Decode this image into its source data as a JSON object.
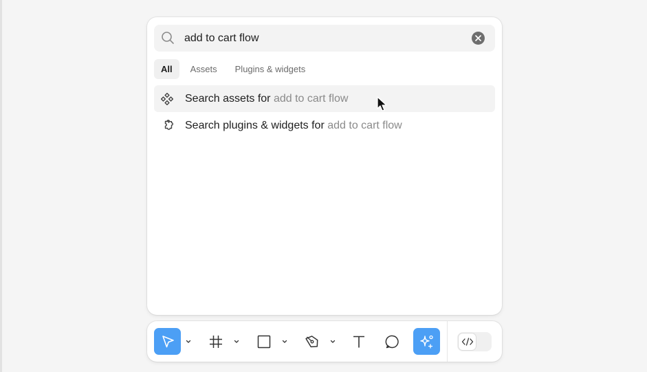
{
  "search": {
    "value": "add to cart flow",
    "placeholder": ""
  },
  "filter_tabs": [
    {
      "label": "All",
      "active": true
    },
    {
      "label": "Assets",
      "active": false
    },
    {
      "label": "Plugins & widgets",
      "active": false
    }
  ],
  "results": [
    {
      "icon": "component-icon",
      "prefix": "Search assets for",
      "query": "add to cart flow"
    },
    {
      "icon": "plugin-icon",
      "prefix": "Search plugins & widgets for",
      "query": "add to cart flow"
    }
  ],
  "toolbar": {
    "tools": [
      {
        "icon": "move-icon",
        "active": true
      },
      {
        "icon": "frame-icon",
        "active": false
      },
      {
        "icon": "rectangle-icon",
        "active": false
      },
      {
        "icon": "pen-icon",
        "active": false
      },
      {
        "icon": "text-icon",
        "active": false
      },
      {
        "icon": "comment-icon",
        "active": false
      },
      {
        "icon": "actions-icon",
        "active": true
      }
    ],
    "dev_mode_icon": "code-icon"
  },
  "colors": {
    "accent": "#4c9ff5",
    "background": "#f5f5f5",
    "panel": "#ffffff",
    "muted_text": "#8a8a8a"
  }
}
